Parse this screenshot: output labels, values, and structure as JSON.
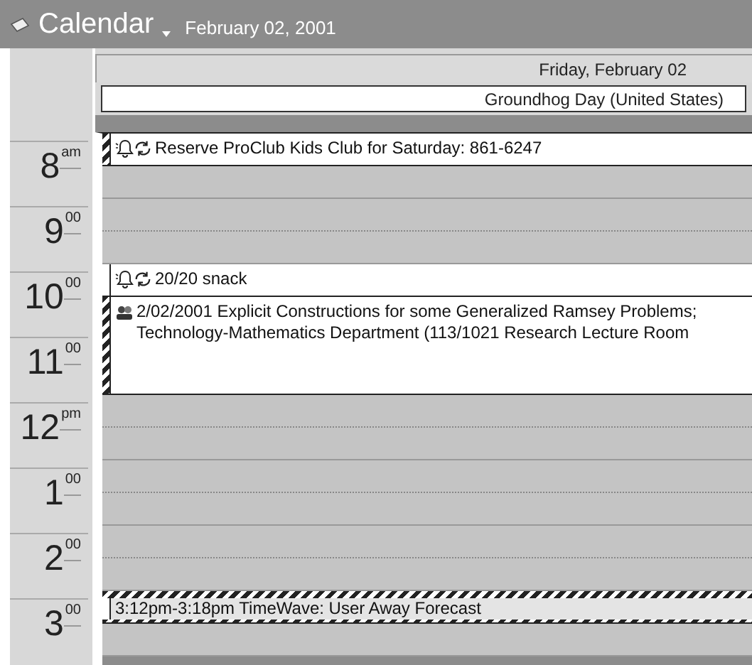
{
  "header": {
    "title": "Calendar",
    "date": "February 02, 2001"
  },
  "day": {
    "label": "Friday, February 02",
    "holiday": "Groundhog Day (United States)"
  },
  "hours": [
    {
      "hour": "8",
      "suffix": "am"
    },
    {
      "hour": "9",
      "suffix": "00"
    },
    {
      "hour": "10",
      "suffix": "00"
    },
    {
      "hour": "11",
      "suffix": "00"
    },
    {
      "hour": "12",
      "suffix": "pm"
    },
    {
      "hour": "1",
      "suffix": "00"
    },
    {
      "hour": "2",
      "suffix": "00"
    },
    {
      "hour": "3",
      "suffix": "00"
    }
  ],
  "timeline": [
    {
      "kind": "event",
      "busy": true,
      "reminder": true,
      "recurring": true,
      "meeting": false,
      "lines": [
        "Reserve ProClub Kids Club for Saturday: 861-6247"
      ]
    },
    {
      "kind": "empty"
    },
    {
      "kind": "empty"
    },
    {
      "kind": "empty"
    },
    {
      "kind": "event",
      "busy": false,
      "reminder": true,
      "recurring": true,
      "meeting": false,
      "lines": [
        "20/20 snack"
      ]
    },
    {
      "kind": "long",
      "busy": true,
      "reminder": false,
      "recurring": false,
      "meeting": true,
      "lines": [
        "2/02/2001 Explicit Constructions for some Generalized Ramsey Problems;",
        "Technology-Mathematics Department (113/1021 Research Lecture Room"
      ]
    },
    {
      "kind": "empty"
    },
    {
      "kind": "empty"
    },
    {
      "kind": "empty"
    },
    {
      "kind": "empty"
    },
    {
      "kind": "empty"
    },
    {
      "kind": "empty"
    },
    {
      "kind": "brief",
      "busy": false,
      "reminder": false,
      "recurring": false,
      "meeting": false,
      "lines": [
        "3:12pm-3:18pm TimeWave: User Away Forecast"
      ]
    },
    {
      "kind": "empty"
    }
  ]
}
